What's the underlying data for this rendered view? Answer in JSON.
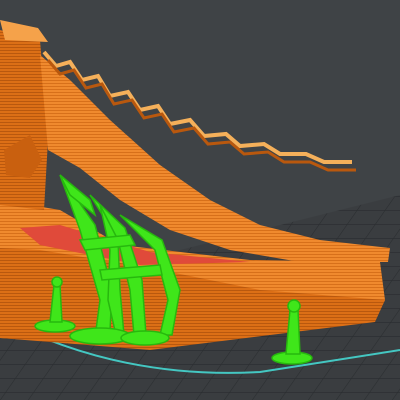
{
  "viewer": {
    "colors": {
      "background": "#3f4346",
      "bed_grid": "#2b2e31",
      "bed_edge": "#44c7c2",
      "model_light": "#f08a2e",
      "model_dark": "#d96a12",
      "model_shadow": "#b9580e",
      "support_fill": "#3fe61a",
      "support_dark": "#27b80e",
      "interior": "#e04a3a"
    },
    "objects": [
      {
        "name": "printed-part",
        "icon": "sliced-model"
      },
      {
        "name": "support-structures",
        "icon": "tree-supports"
      },
      {
        "name": "print-bed",
        "icon": "build-plate-grid"
      }
    ]
  }
}
